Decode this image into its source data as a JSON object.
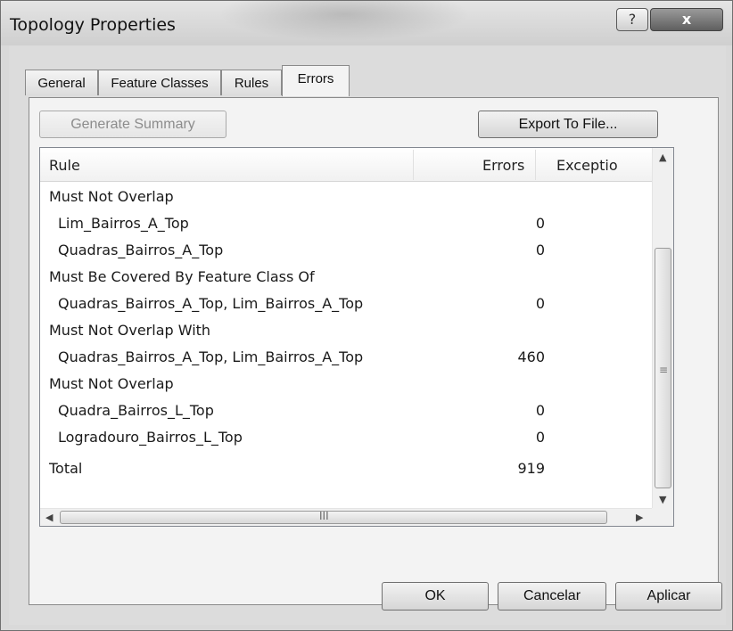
{
  "window": {
    "title": "Topology Properties",
    "help_label": "?",
    "close_label": "x"
  },
  "tabs": [
    {
      "label": "General"
    },
    {
      "label": "Feature Classes"
    },
    {
      "label": "Rules"
    },
    {
      "label": "Errors",
      "active": true
    }
  ],
  "toolbar": {
    "generate_label": "Generate Summary",
    "export_label": "Export To File..."
  },
  "table": {
    "columns": [
      "Rule",
      "Errors",
      "Exceptio"
    ],
    "rows": [
      {
        "rule": "Must Not Overlap",
        "errors": "",
        "indent": false
      },
      {
        "rule": "Lim_Bairros_A_Top",
        "errors": "0",
        "indent": true
      },
      {
        "rule": "Quadras_Bairros_A_Top",
        "errors": "0",
        "indent": true
      },
      {
        "rule": "Must Be Covered By Feature Class Of",
        "errors": "",
        "indent": false
      },
      {
        "rule": "Quadras_Bairros_A_Top, Lim_Bairros_A_Top",
        "errors": "0",
        "indent": true
      },
      {
        "rule": "Must Not Overlap With",
        "errors": "",
        "indent": false
      },
      {
        "rule": "Quadras_Bairros_A_Top, Lim_Bairros_A_Top",
        "errors": "460",
        "indent": true
      },
      {
        "rule": "Must Not Overlap",
        "errors": "",
        "indent": false
      },
      {
        "rule": "Quadra_Bairros_L_Top",
        "errors": "0",
        "indent": true
      },
      {
        "rule": "Logradouro_Bairros_L_Top",
        "errors": "0",
        "indent": true
      }
    ],
    "total": {
      "label": "Total",
      "errors": "919"
    }
  },
  "scrollbar": {
    "hthumb_label": "III"
  },
  "footer": {
    "ok_label": "OK",
    "cancel_label": "Cancelar",
    "apply_label": "Aplicar"
  }
}
